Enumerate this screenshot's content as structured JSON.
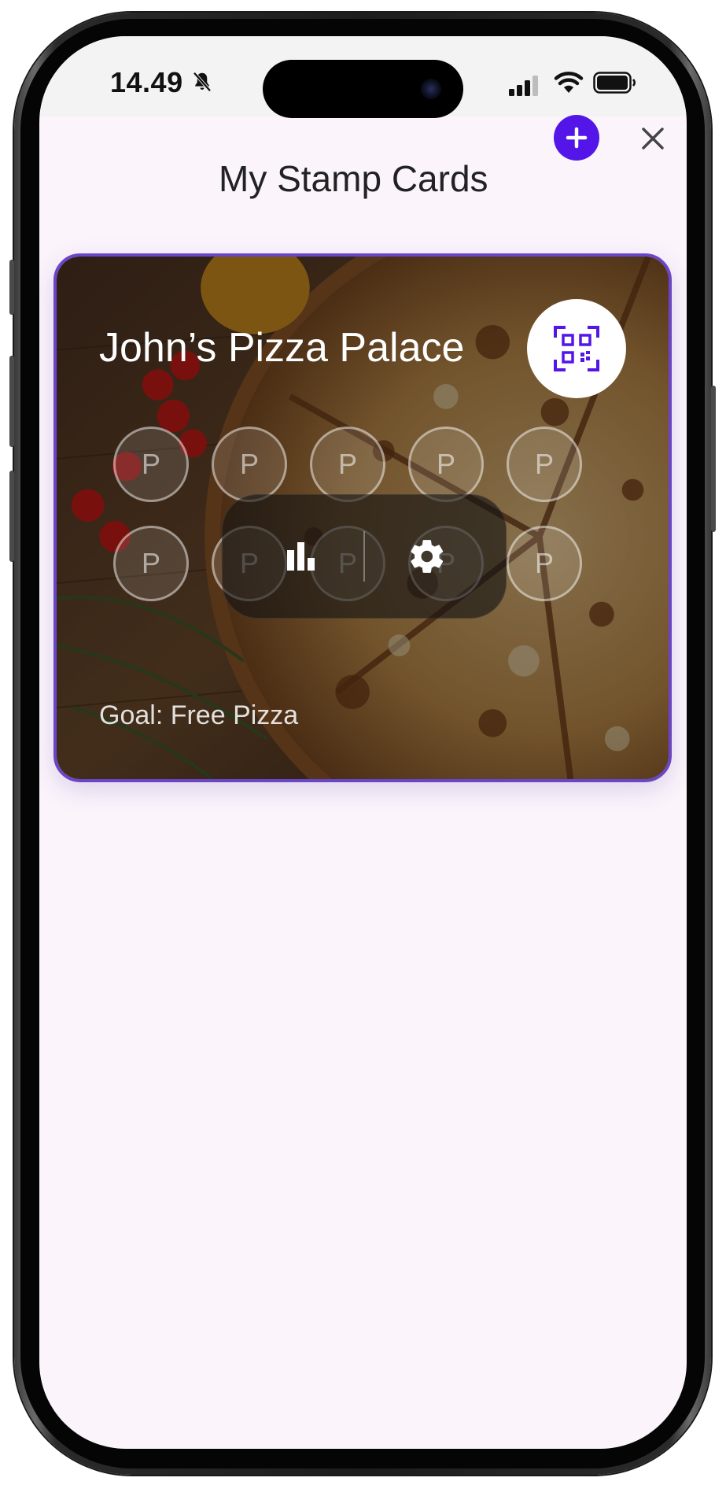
{
  "status_bar": {
    "time": "14.49",
    "icons": [
      "bell-slash-icon",
      "cellular-signal-icon",
      "wifi-icon",
      "battery-icon"
    ]
  },
  "header": {
    "title": "My Stamp Cards",
    "add_icon": "plus-icon",
    "close_icon": "close-icon"
  },
  "card": {
    "name": "John’s Pizza Palace",
    "qr_icon": "qr-code-icon",
    "stamps": [
      "P",
      "P",
      "P",
      "P",
      "P",
      "P",
      "P",
      "P",
      "P",
      "P"
    ],
    "actions": [
      {
        "icon": "bar-chart-icon"
      },
      {
        "icon": "gear-icon"
      }
    ],
    "goal": "Goal: Free Pizza"
  },
  "colors": {
    "accent": "#5416e8",
    "card_border": "#6b45c7",
    "background": "#fbf4fb"
  }
}
